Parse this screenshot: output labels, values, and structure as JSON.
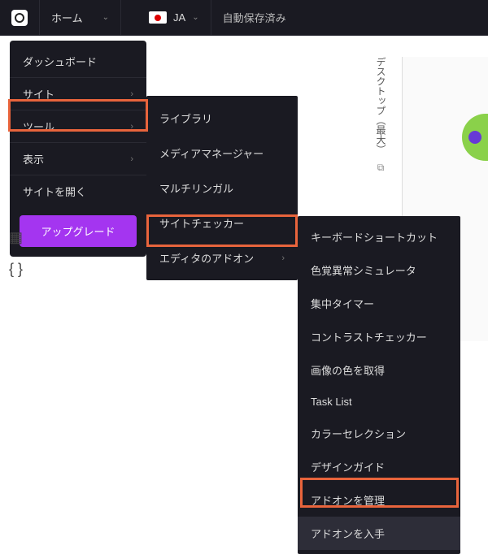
{
  "topbar": {
    "home_label": "ホーム",
    "lang_label": "JA",
    "autosave_label": "自動保存済み"
  },
  "menu1": {
    "items": [
      {
        "label": "ダッシュボード",
        "arrow": false
      },
      {
        "label": "サイト",
        "arrow": true
      },
      {
        "label": "ツール",
        "arrow": true
      },
      {
        "label": "表示",
        "arrow": true
      },
      {
        "label": "サイトを開く",
        "arrow": false
      }
    ],
    "upgrade_label": "アップグレード"
  },
  "menu2": {
    "items": [
      {
        "label": "ライブラリ",
        "arrow": false
      },
      {
        "label": "メディアマネージャー",
        "arrow": false
      },
      {
        "label": "マルチリンガル",
        "arrow": false
      },
      {
        "label": "サイトチェッカー",
        "arrow": false
      },
      {
        "label": "エディタのアドオン",
        "arrow": true
      }
    ]
  },
  "menu3": {
    "items": [
      "キーボードショートカット",
      "色覚異常シミュレータ",
      "集中タイマー",
      "コントラストチェッカー",
      "画像の色を取得",
      "Task List",
      "カラーセレクション",
      "デザインガイド",
      "アドオンを管理",
      "アドオンを入手"
    ]
  },
  "desktop_label": "デスクトップ（最大）",
  "icons": {
    "copy": "⧉",
    "table": "▦",
    "braces": "{ }"
  }
}
